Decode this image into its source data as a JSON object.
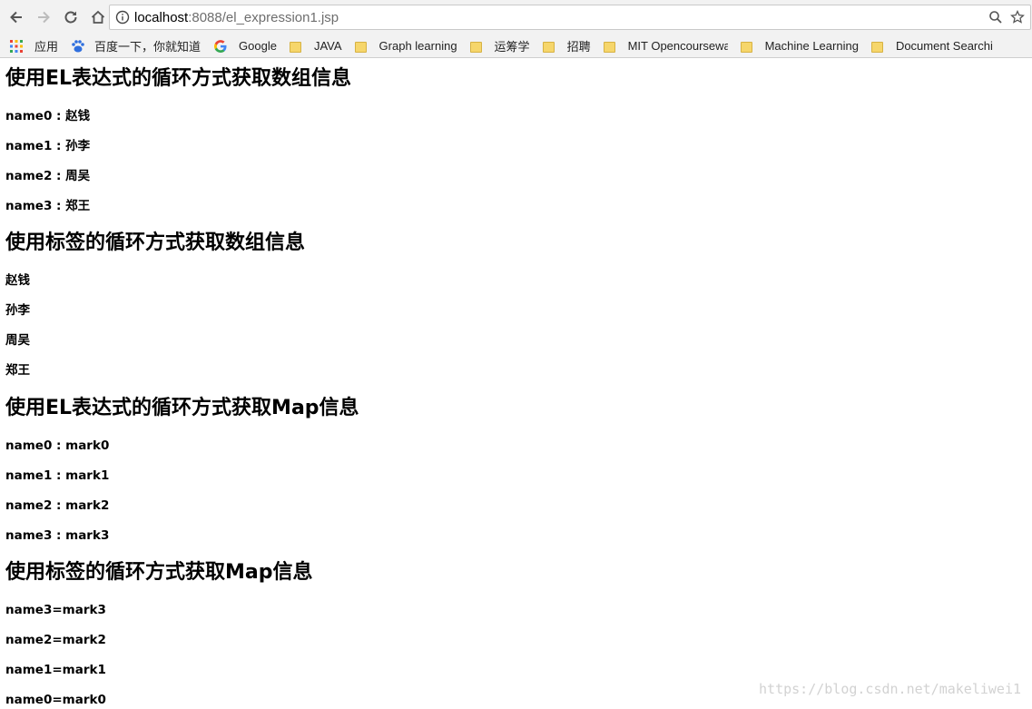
{
  "browser": {
    "url_host": "localhost",
    "url_path": ":8088/el_expression1.jsp",
    "bookmarks": [
      {
        "label": "应用",
        "icon": "apps-grid-icon"
      },
      {
        "label": "百度一下，你就知道",
        "icon": "baidu-paw-icon"
      },
      {
        "label": "Google",
        "icon": "google-g-icon"
      },
      {
        "label": "JAVA",
        "icon": "folder-icon"
      },
      {
        "label": "Graph learning",
        "icon": "folder-icon"
      },
      {
        "label": "运筹学",
        "icon": "folder-icon"
      },
      {
        "label": "招聘",
        "icon": "folder-icon"
      },
      {
        "label": "MIT Opencoursewa",
        "icon": "folder-icon"
      },
      {
        "label": "Machine Learning",
        "icon": "folder-icon"
      },
      {
        "label": "Document Searchi",
        "icon": "folder-icon"
      }
    ]
  },
  "page": {
    "sections": [
      {
        "title": "使用EL表达式的循环方式获取数组信息",
        "items": [
          "name0 : 赵钱",
          "name1 : 孙李",
          "name2 : 周吴",
          "name3 : 郑王"
        ]
      },
      {
        "title": "使用标签的循环方式获取数组信息",
        "items": [
          "赵钱",
          "孙李",
          "周吴",
          "郑王"
        ]
      },
      {
        "title": "使用EL表达式的循环方式获取Map信息",
        "items": [
          "name0 : mark0",
          "name1 : mark1",
          "name2 : mark2",
          "name3 : mark3"
        ]
      },
      {
        "title": "使用标签的循环方式获取Map信息",
        "items": [
          "name3=mark3",
          "name2=mark2",
          "name1=mark1",
          "name0=mark0"
        ]
      }
    ]
  },
  "watermark": "https://blog.csdn.net/makeliwei1"
}
